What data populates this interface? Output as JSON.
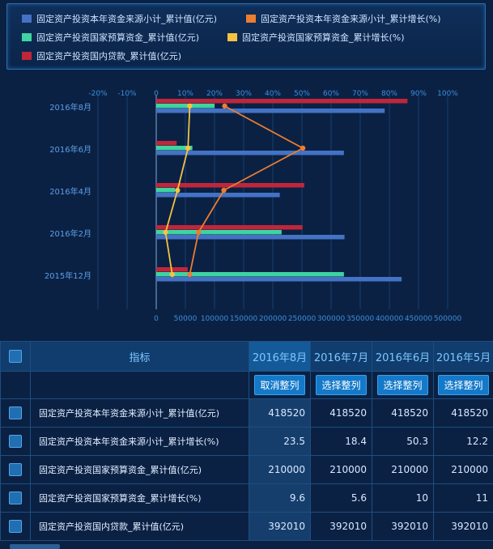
{
  "legend": [
    {
      "label": "固定资产投资本年资金来源小计_累计值(亿元)",
      "color": "#4472c4"
    },
    {
      "label": "固定资产投资本年资金来源小计_累计增长(%)",
      "color": "#ed7d31"
    },
    {
      "label": "固定资产投资国家预算资金_累计值(亿元)",
      "color": "#3fd3a2"
    },
    {
      "label": "固定资产投资国家预算资金_累计增长(%)",
      "color": "#f5c242"
    },
    {
      "label": "固定资产投资国内贷款_累计值(亿元)",
      "color": "#c0263a"
    }
  ],
  "chart_data": {
    "type": "bar",
    "orientation": "horizontal",
    "categories": [
      "2016年8月",
      "2016年6月",
      "2016年4月",
      "2016年2月",
      "2015年12月"
    ],
    "series": [
      {
        "name": "固定资产投资本年资金来源小计_累计值(亿元)",
        "type": "bar",
        "axis": "bottom",
        "color": "#4472c4",
        "values": [
          392000,
          322000,
          212000,
          323000,
          421000
        ]
      },
      {
        "name": "固定资产投资国家预算资金_累计值(亿元)",
        "type": "bar",
        "axis": "bottom",
        "color": "#3fd3a2",
        "values": [
          100000,
          62000,
          32000,
          215000,
          322000
        ]
      },
      {
        "name": "固定资产投资国内贷款_累计值(亿元)",
        "type": "bar",
        "axis": "bottom",
        "color": "#c0263a",
        "values": [
          431000,
          35000,
          254000,
          251000,
          54000
        ]
      },
      {
        "name": "固定资产投资本年资金来源小计_累计增长(%)",
        "type": "line",
        "axis": "top",
        "color": "#ed7d31",
        "values": [
          23.5,
          50.3,
          23.2,
          14.5,
          11.5
        ]
      },
      {
        "name": "固定资产投资国家预算资金_累计增长(%)",
        "type": "line",
        "axis": "top",
        "color": "#f5c242",
        "values": [
          11.5,
          10.9,
          7.3,
          3.2,
          5.5
        ]
      }
    ],
    "x_bottom": {
      "ticks": [
        "0",
        "50000",
        "100000",
        "150000",
        "200000",
        "250000",
        "300000",
        "350000",
        "400000",
        "450000",
        "500000"
      ],
      "range": [
        0,
        500000
      ]
    },
    "x_top": {
      "ticks": [
        "-20%",
        "-10%",
        "0",
        "10%",
        "20%",
        "30%",
        "40%",
        "50%",
        "60%",
        "70%",
        "80%",
        "90%",
        "100%"
      ],
      "range": [
        -20,
        100
      ]
    },
    "grid": true,
    "legend_position": "top"
  },
  "table": {
    "header_label": "指标",
    "columns": [
      "2016年8月",
      "2016年7月",
      "2016年6月",
      "2016年5月"
    ],
    "buttons": [
      "取消整列",
      "选择整列",
      "选择整列",
      "选择整列"
    ],
    "rows": [
      {
        "name": "固定资产投资本年资金来源小计_累计值(亿元)",
        "values": [
          "418520",
          "418520",
          "418520",
          "418520"
        ]
      },
      {
        "name": "固定资产投资本年资金来源小计_累计增长(%)",
        "values": [
          "23.5",
          "18.4",
          "50.3",
          "12.2"
        ]
      },
      {
        "name": "固定资产投资国家预算资金_累计值(亿元)",
        "values": [
          "210000",
          "210000",
          "210000",
          "210000"
        ]
      },
      {
        "name": "固定资产投资国家预算资金_累计增长(%)",
        "values": [
          "9.6",
          "5.6",
          "10",
          "11"
        ]
      },
      {
        "name": "固定资产投资国内贷款_累计值(亿元)",
        "values": [
          "392010",
          "392010",
          "392010",
          "392010"
        ]
      }
    ]
  }
}
